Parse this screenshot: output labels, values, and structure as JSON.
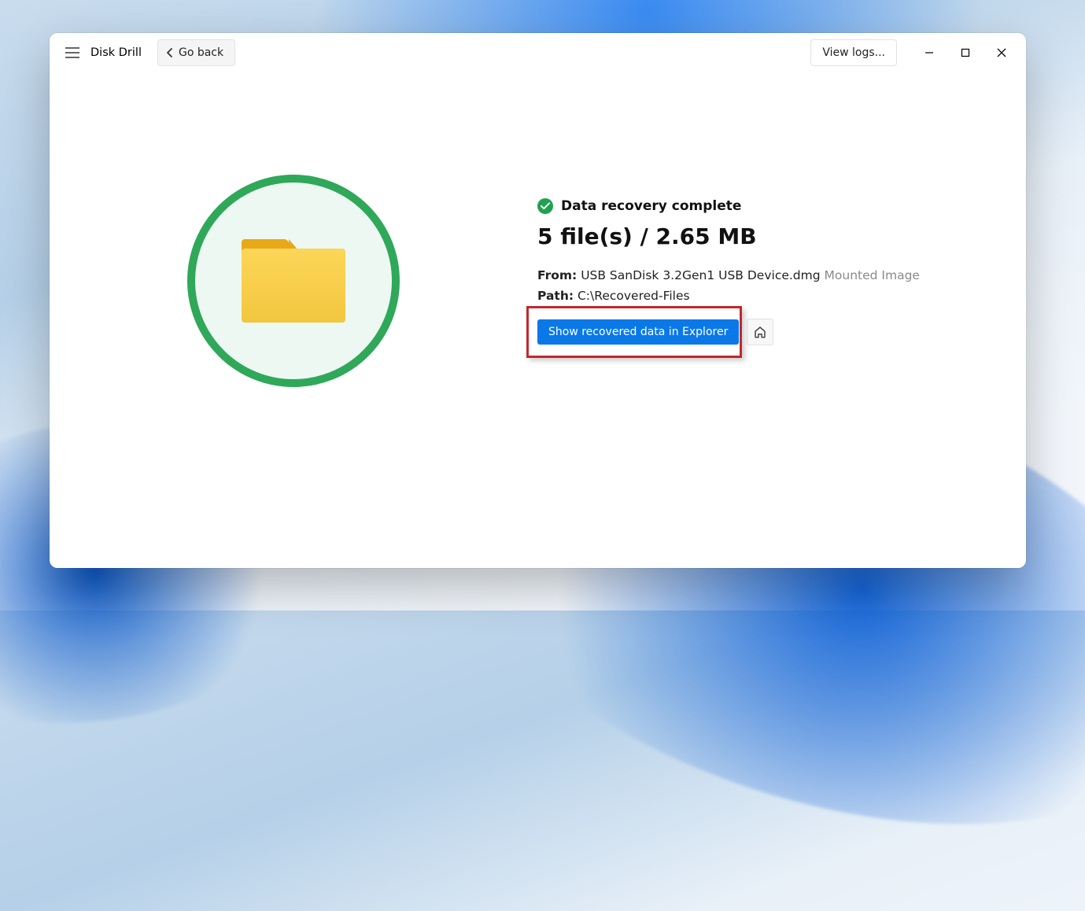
{
  "titlebar": {
    "app_name": "Disk Drill",
    "go_back": "Go back",
    "view_logs": "View logs..."
  },
  "result": {
    "status": "Data recovery complete",
    "summary": "5 file(s) / 2.65 MB",
    "from_label": "From:",
    "from_value": "USB  SanDisk 3.2Gen1 USB Device.dmg",
    "from_tag": "Mounted Image",
    "path_label": "Path:",
    "path_value": "C:\\Recovered-Files",
    "show_btn": "Show recovered data in Explorer"
  }
}
